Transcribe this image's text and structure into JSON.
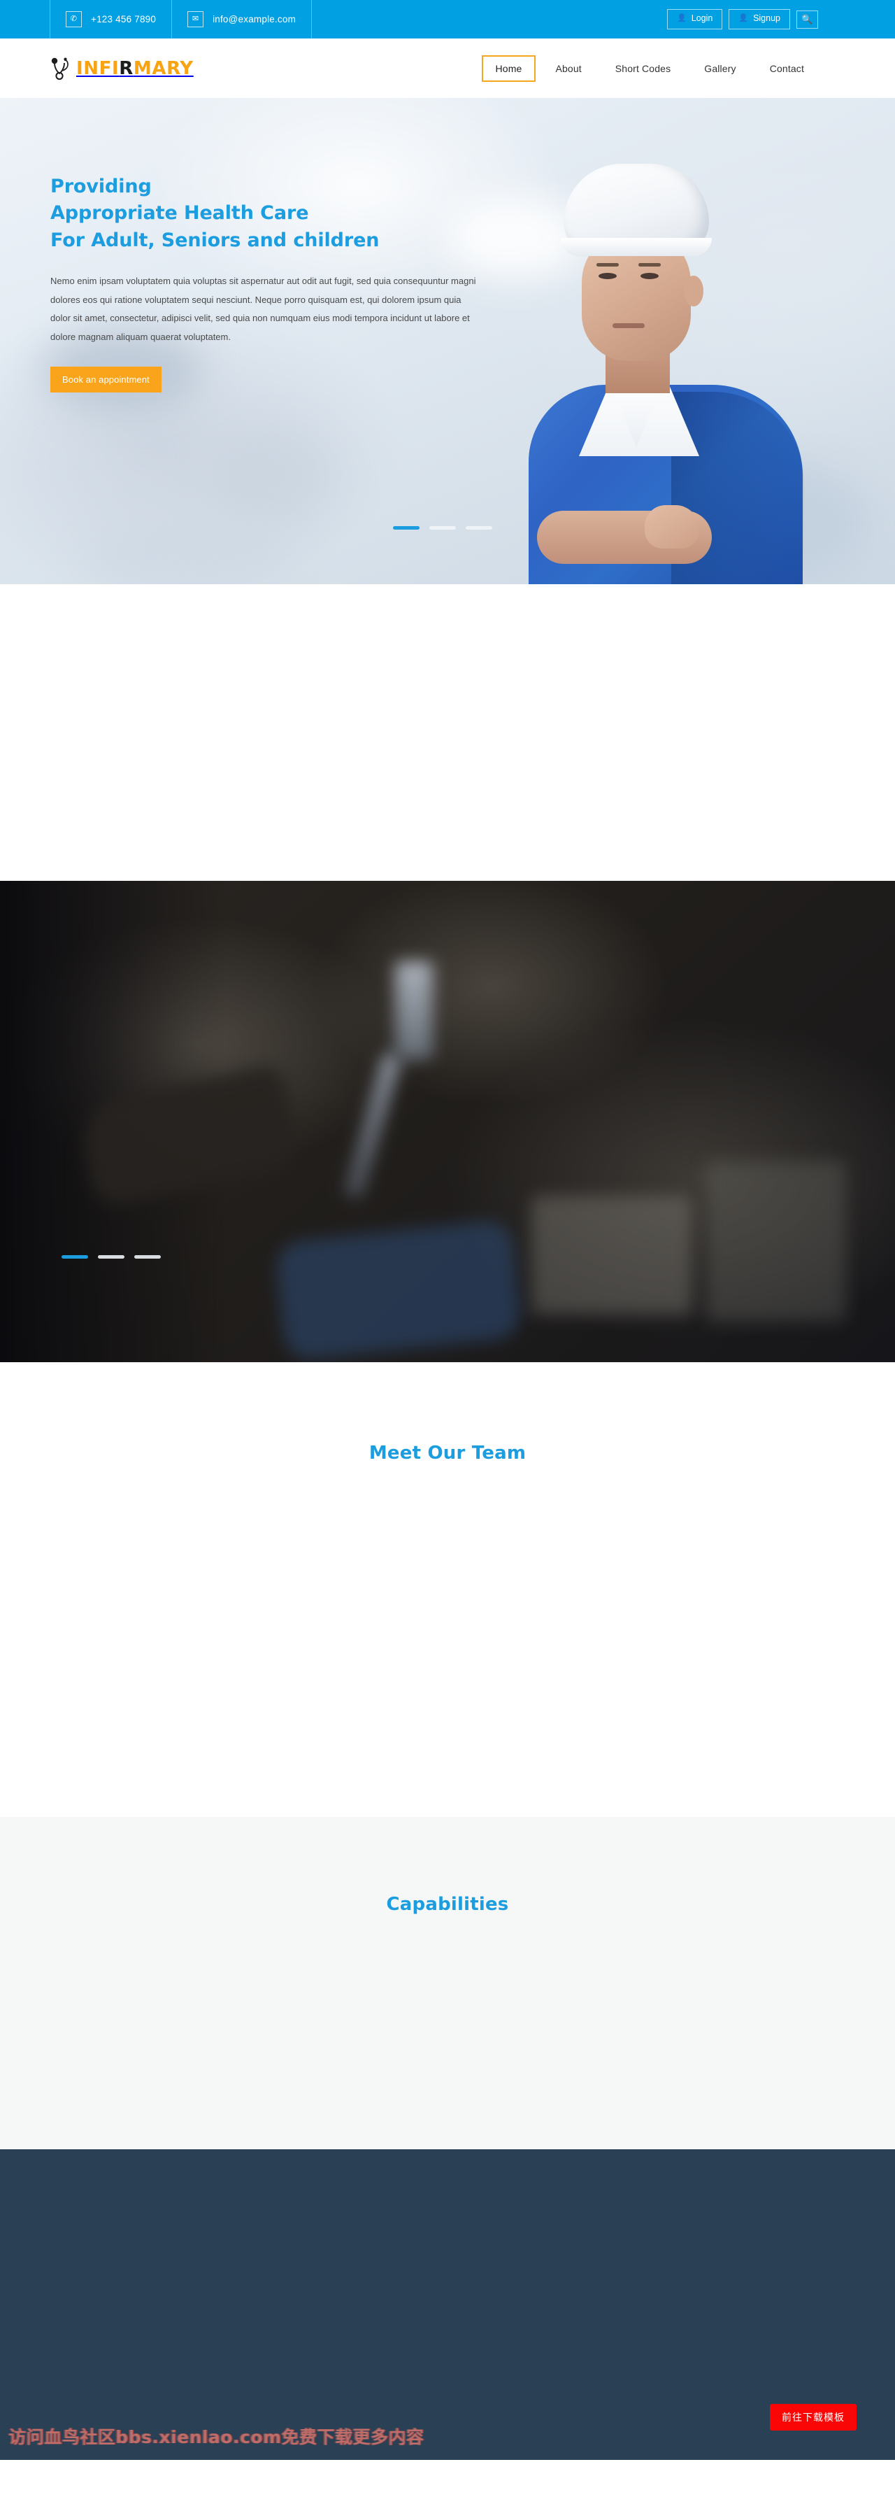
{
  "topbar": {
    "phone": "+123 456 7890",
    "phone_icon": "phone-icon",
    "email": "info@example.com",
    "email_icon": "envelope-icon",
    "login_label": "Login",
    "signup_label": "Signup",
    "user_icon": "user-icon",
    "search_icon": "search-icon",
    "bg_color": "#00a0e3"
  },
  "header": {
    "logo_icon": "stethoscope-icon",
    "logo_part1": "INFI",
    "logo_part2": "R",
    "logo_part3": "MARY",
    "logo_color": "#f7a313",
    "logo_accent_color": "#1c1c1c",
    "nav": [
      {
        "label": "Home",
        "active": true
      },
      {
        "label": "About",
        "active": false
      },
      {
        "label": "Short Codes",
        "active": false
      },
      {
        "label": "Gallery",
        "active": false
      },
      {
        "label": "Contact",
        "active": false
      }
    ],
    "active_border_color": "#f4a81d"
  },
  "hero": {
    "headline_line1": "Providing",
    "headline_line2": "Appropriate Health Care",
    "headline_line3": "For Adult, Seniors and children",
    "headline_color": "#1b9ddf",
    "paragraph": "Nemo enim ipsam voluptatem quia voluptas sit aspernatur aut odit aut fugit, sed quia consequuntur magni dolores eos qui ratione voluptatem sequi nesciunt. Neque porro quisquam est, qui dolorem ipsum quia dolor sit amet, consectetur, adipisci velit, sed quia non numquam eius modi tempora incidunt ut labore et dolore magnam aliquam quaerat voluptatem.",
    "cta_label": "Book an appointment",
    "cta_color": "#f9a41b",
    "slides": [
      {
        "active": true
      },
      {
        "active": false
      },
      {
        "active": false
      }
    ]
  },
  "dark_slider": {
    "slides": [
      {
        "active": true
      },
      {
        "active": false
      },
      {
        "active": false
      }
    ],
    "active_color": "#1b9ddf",
    "inactive_color": "#d9dde1"
  },
  "team": {
    "title": "Meet Our Team",
    "title_color": "#1b9ddf"
  },
  "capabilities": {
    "title": "Capabilities",
    "title_color": "#1b9ddf",
    "bg_color": "#f6f8f8"
  },
  "footer": {
    "bg_color": "#2a4055",
    "watermark": "访问血鸟社区bbs.xienlao.com免费下载更多内容",
    "download_label": "前往下载模板",
    "download_color": "#fb0606"
  }
}
